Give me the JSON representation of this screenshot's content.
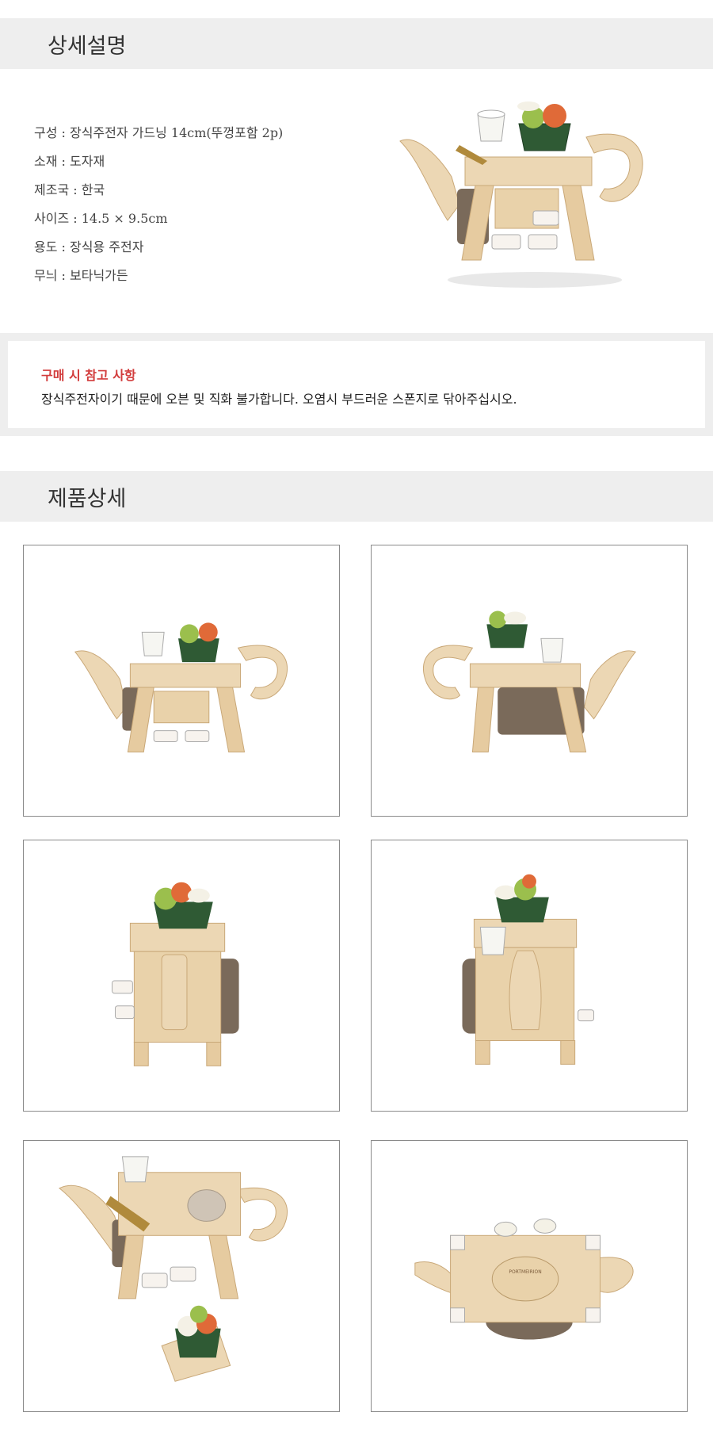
{
  "section_detail": {
    "title": "상세설명"
  },
  "specs": [
    "구성 : 장식주전자 가드닝 14cm(뚜껑포함 2p)",
    "소재 : 도자재",
    "제조국 : 한국",
    "사이즈 : 14.5 × 9.5cm",
    "용도 : 장식용 주전자",
    "무늬 : 보타닉가든"
  ],
  "notice": {
    "title": "구매 시 참고 사항",
    "text": "장식주전자이기 때문에 오븐 및 직화 불가합니다. 오염시 부드러운 스폰지로 닦아주십시오."
  },
  "section_product": {
    "title": "제품상세"
  },
  "photos": [
    {
      "name": "teapot-front-view-image"
    },
    {
      "name": "teapot-back-view-image"
    },
    {
      "name": "teapot-side-view-left-image"
    },
    {
      "name": "teapot-side-view-right-image"
    },
    {
      "name": "teapot-lid-off-view-image"
    },
    {
      "name": "teapot-bottom-view-image"
    }
  ],
  "bottom_stamp_text": "PORTMEIRION",
  "colors": {
    "header_bg": "#eeeeee",
    "notice_title": "#d23c3c",
    "wood": "#ecd7b4",
    "basket": "#2f5a34"
  }
}
